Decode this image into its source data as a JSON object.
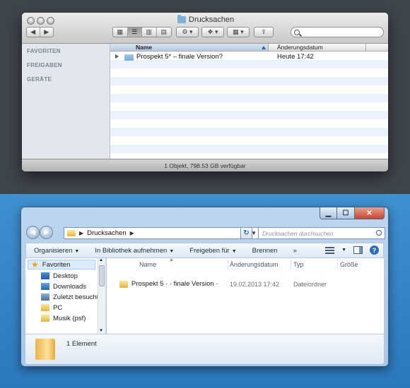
{
  "mac": {
    "title": "Drucksachen",
    "sidebar": {
      "sections": [
        "FAVORITEN",
        "FREIGABEN",
        "GERÄTE"
      ]
    },
    "columns": {
      "name": "Name",
      "date": "Änderungsdatum"
    },
    "file": {
      "name": "Prospekt 5* – finale Version?",
      "date": "Heute 17:42"
    },
    "status": "1 Objekt, 798.53 GB verfügbar"
  },
  "win": {
    "address": {
      "folder": "Drucksachen"
    },
    "search_placeholder": "Drucksachen durchsuchen",
    "commands": {
      "organize": "Organisieren",
      "library": "In Bibliothek aufnehmen",
      "share": "Freigeben für",
      "burn": "Brennen",
      "more": "»"
    },
    "nav": {
      "favorites": "Favoriten",
      "items": [
        "Desktop",
        "Downloads",
        "Zuletzt besucht",
        "PC",
        "Musik (psf)"
      ]
    },
    "columns": {
      "name": "Name",
      "date": "Änderungsdatum",
      "type": "Typ",
      "size": "Größe"
    },
    "file": {
      "name": "Prospekt 5 ·  · finale Version ·",
      "date": "19.02.2013 17:42",
      "type": "Dateiordner"
    },
    "details": "1 Element"
  }
}
